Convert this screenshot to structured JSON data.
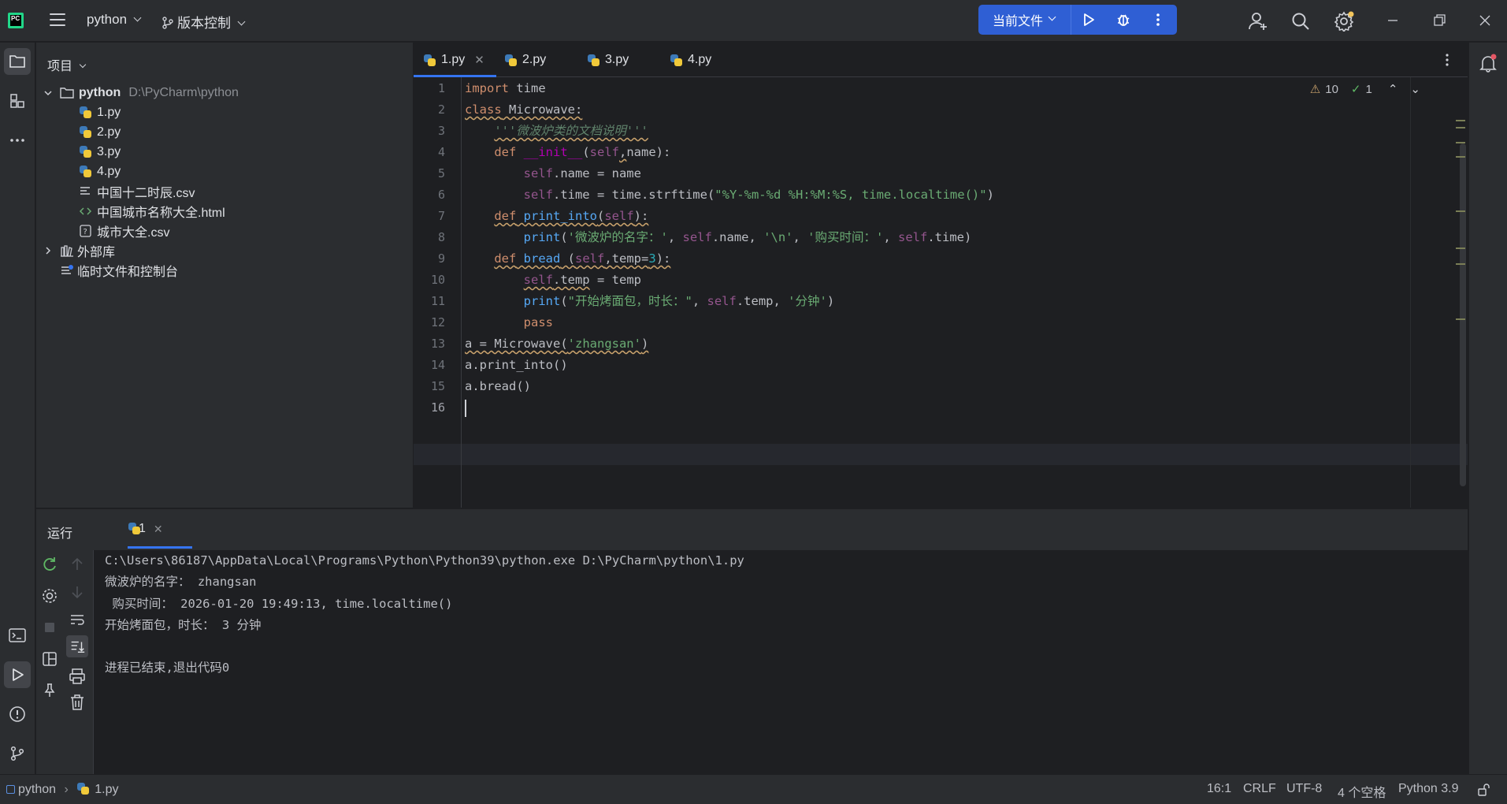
{
  "titlebar": {
    "project": "python",
    "vcs": "版本控制",
    "run_config": "当前文件"
  },
  "project_panel": {
    "header": "项目",
    "root_name": "python",
    "root_path": "D:\\PyCharm\\python",
    "files": [
      "1.py",
      "2.py",
      "3.py",
      "4.py",
      "中国十二时辰.csv",
      "中国城市名称大全.html",
      "城市大全.csv"
    ],
    "external": "外部库",
    "scratches": "临时文件和控制台"
  },
  "editor": {
    "tabs": [
      "1.py",
      "2.py",
      "3.py",
      "4.py"
    ],
    "warnings": "10",
    "ok_count": "1",
    "line_numbers": [
      "1",
      "2",
      "3",
      "4",
      "5",
      "6",
      "7",
      "8",
      "9",
      "10",
      "11",
      "12",
      "13",
      "14",
      "15",
      "16"
    ]
  },
  "run_panel": {
    "title": "运行",
    "tab": "1",
    "output": [
      "C:\\Users\\86187\\AppData\\Local\\Programs\\Python\\Python39\\python.exe D:\\PyCharm\\python\\1.py",
      "微波炉的名字： zhangsan",
      " 购买时间： 2026-01-20 19:49:13, time.localtime()",
      "开始烤面包，时长： 3 分钟",
      "",
      "进程已结束,退出代码0"
    ]
  },
  "statusbar": {
    "crumb_project": "python",
    "crumb_file": "1.py",
    "position": "16:1",
    "line_sep": "CRLF",
    "encoding": "UTF-8",
    "indent": "4 个空格",
    "interpreter": "Python 3.9"
  },
  "colors": {
    "accent": "#3574f0",
    "run_button": "#2f5fd4",
    "keyword": "#cf8e6d",
    "string": "#6aab73"
  }
}
